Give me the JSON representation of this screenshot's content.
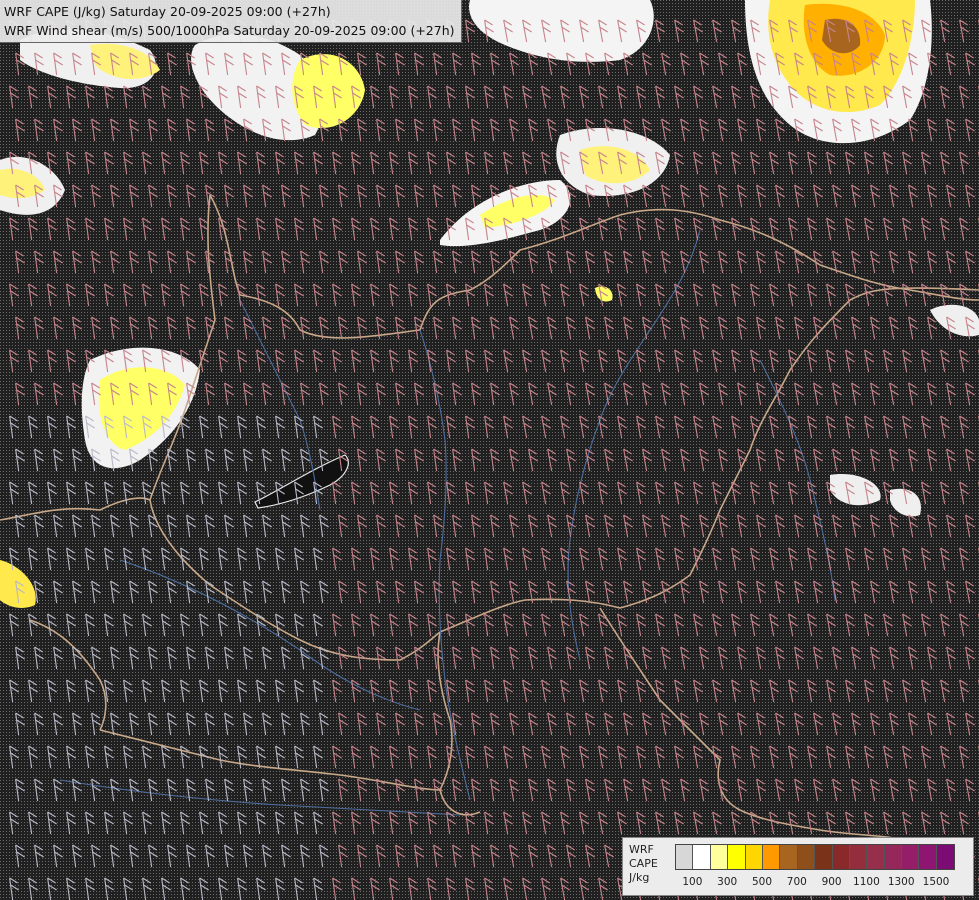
{
  "header": {
    "line1": "WRF CAPE (J/kg) Saturday 20-09-2025 09:00 (+27h)",
    "line2": "WRF Wind shear (m/s) 500/1000hPa Saturday 20-09-2025 09:00 (+27h)"
  },
  "legend": {
    "title_lines": [
      "WRF",
      "CAPE",
      "J/kg"
    ],
    "tick_labels": [
      "100",
      "300",
      "500",
      "700",
      "900",
      "1100",
      "1300",
      "1500"
    ],
    "colors": [
      "#d7d7d7",
      "#ffffff",
      "#ffff9b",
      "#ffff00",
      "#ffd700",
      "#ff9900",
      "#a8651f",
      "#8e4f1a",
      "#7a3318",
      "#8a2929",
      "#952e3c",
      "#962e4c",
      "#96275a",
      "#941f68",
      "#8f1573",
      "#7c0b73"
    ]
  },
  "colors": {
    "background": "#1a1a1a",
    "border_lines": "#c8a888",
    "rivers": "#4c6d9e",
    "wind_barbs_low": "#b9b9c8",
    "wind_barbs_mid": "#c8848c",
    "wind_barbs_high": "#ff00ff",
    "cape_low": "#ffffff",
    "cape_mid": "#ffff66",
    "cape_high": "#ffaa00"
  }
}
